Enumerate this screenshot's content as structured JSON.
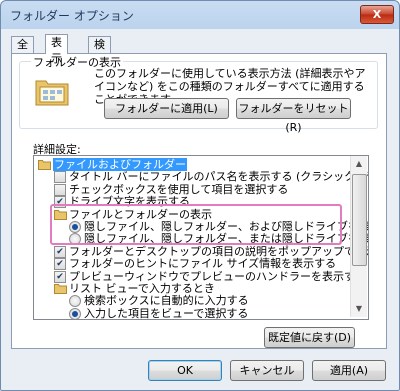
{
  "window": {
    "title": "フォルダー オプション",
    "close": "X"
  },
  "tabs": [
    {
      "label": "全般"
    },
    {
      "label": "表示"
    },
    {
      "label": "検索"
    }
  ],
  "folder_view": {
    "label": "フォルダーの表示",
    "description": "このフォルダーに使用している表示方法 (詳細表示やアイコンなど) をこの種類のフォルダーすべてに適用することができます。",
    "apply_button": "フォルダーに適用(L)",
    "reset_button": "フォルダーをリセット(R)"
  },
  "advanced": {
    "label": "詳細設定:",
    "items": [
      {
        "kind": "folder",
        "indent": 0,
        "label": "ファイルおよびフォルダー",
        "selected": true
      },
      {
        "kind": "check",
        "indent": 1,
        "checked": false,
        "label": "タイトル バーにファイルのパス名を表示する (クラシック テーマのみ)"
      },
      {
        "kind": "check",
        "indent": 1,
        "checked": false,
        "label": "チェックボックスを使用して項目を選択する"
      },
      {
        "kind": "check",
        "indent": 1,
        "checked": true,
        "label": "ドライブ文字を表示する"
      },
      {
        "kind": "folder",
        "indent": 1,
        "label": "ファイルとフォルダーの表示"
      },
      {
        "kind": "radio",
        "indent": 2,
        "checked": true,
        "label": "隠しファイル、隠しフォルダー、および隠しドライブを表示する"
      },
      {
        "kind": "radio",
        "indent": 2,
        "checked": false,
        "label": "隠しファイル、隠しフォルダー、または隠しドライブを表示しない"
      },
      {
        "kind": "check",
        "indent": 1,
        "checked": true,
        "label": "フォルダーとデスクトップの項目の説明をポップアップで表示する"
      },
      {
        "kind": "check",
        "indent": 1,
        "checked": true,
        "label": "フォルダーのヒントにファイル サイズ情報を表示する"
      },
      {
        "kind": "check",
        "indent": 1,
        "checked": true,
        "label": "プレビューウィンドウでプレビューのハンドラーを表示する"
      },
      {
        "kind": "folder",
        "indent": 1,
        "label": "リスト ビューで入力するとき"
      },
      {
        "kind": "radio",
        "indent": 2,
        "checked": false,
        "label": "検索ボックスに自動的に入力する"
      },
      {
        "kind": "radio",
        "indent": 2,
        "checked": true,
        "label": "入力した項目をビューで選択する"
      }
    ],
    "restore_button": "既定値に戻す(D)"
  },
  "footer": {
    "ok": "OK",
    "cancel": "キャンセル",
    "apply": "適用(A)"
  },
  "colors": {
    "selection": "#3399ff",
    "highlight_box": "#e27bbf"
  }
}
